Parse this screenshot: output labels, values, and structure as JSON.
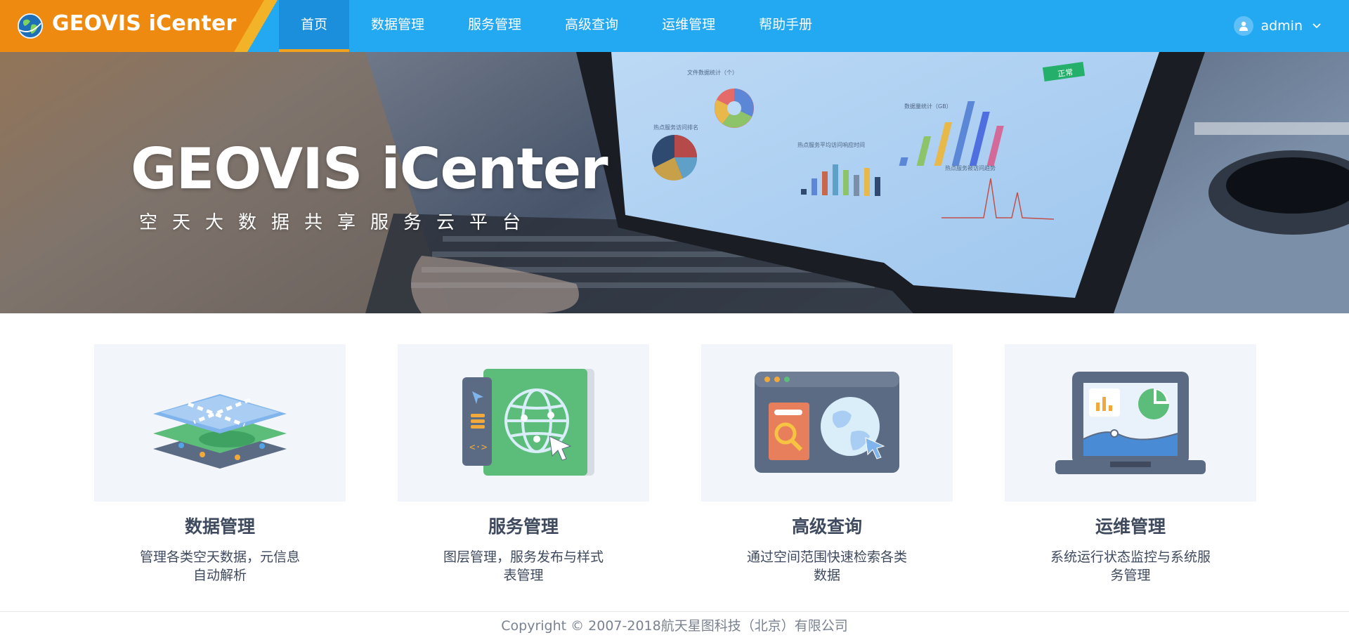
{
  "brand": {
    "name": "GEOVIS iCenter",
    "logo_icon": "globe-icon",
    "color": "#ee8a10"
  },
  "nav": {
    "items": [
      {
        "label": "首页",
        "active": true
      },
      {
        "label": "数据管理"
      },
      {
        "label": "服务管理"
      },
      {
        "label": "高级查询"
      },
      {
        "label": "运维管理"
      },
      {
        "label": "帮助手册"
      }
    ],
    "accent": "#23a8f2",
    "active_underline": "#f1a31f"
  },
  "user": {
    "name": "admin",
    "avatar_icon": "user-icon",
    "menu_icon": "chevron-down-icon"
  },
  "banner": {
    "title": "GEOVIS iCenter",
    "subtitle": "空天大数据共享服务云平台",
    "screen": {
      "panel_file_stats": "文件数据统计（个）",
      "panel_data_volume": "数据量统计（GB）",
      "panel_hot_service": "热点服务访问排名",
      "panel_response_time": "热点服务平均访问响应时间",
      "panel_access_trend": "热点服务被访问趋势",
      "status_badge": "正常"
    }
  },
  "features": [
    {
      "title": "数据管理",
      "desc": "管理各类空天数据，元信息自动解析",
      "icon": "map-layers-icon"
    },
    {
      "title": "服务管理",
      "desc": "图层管理，服务发布与样式表管理",
      "icon": "globe-service-icon"
    },
    {
      "title": "高级查询",
      "desc": "通过空间范围快速检索各类数据",
      "icon": "search-globe-icon"
    },
    {
      "title": "运维管理",
      "desc": "系统运行状态监控与系统服务管理",
      "icon": "monitor-chart-icon"
    }
  ],
  "footer": {
    "copyright": "Copyright © 2007-2018航天星图科技（北京）有限公司"
  }
}
